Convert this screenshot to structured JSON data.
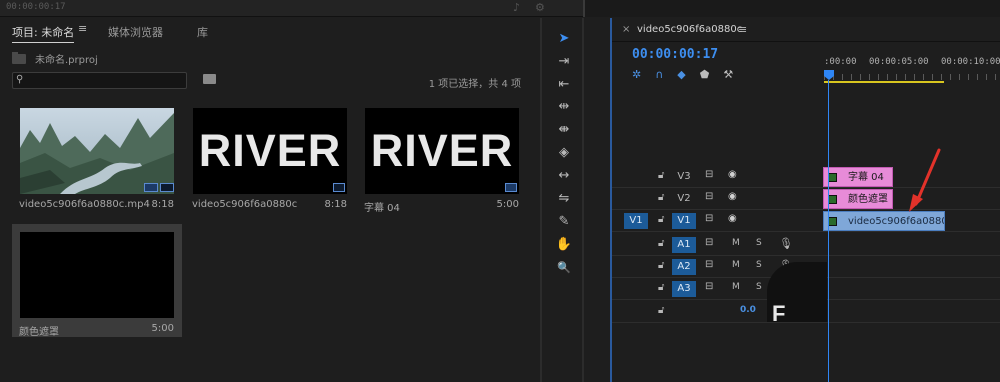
{
  "top_strip": {
    "timecode": "00:00:00:17"
  },
  "project": {
    "tabs": [
      {
        "label": "项目: 未命名"
      },
      {
        "label": "媒体浏览器"
      },
      {
        "label": "库"
      }
    ],
    "tab_menu": "≡",
    "bin_name": "未命名.prproj",
    "search_placeholder": "",
    "selection_status": "1 项已选择，共 4 项",
    "items": [
      {
        "name": "video5c906f6a0880c.mp4",
        "duration": "8:18",
        "kind": "video"
      },
      {
        "name": "video5c906f6a0880c",
        "duration": "8:18",
        "kind": "sequence",
        "thumb_text": "RIVER"
      },
      {
        "name": "字幕 04",
        "duration": "5:00",
        "kind": "title",
        "thumb_text": "RIVER"
      },
      {
        "name": "颜色遮罩",
        "duration": "5:00",
        "kind": "matte"
      }
    ]
  },
  "tools": [
    {
      "name": "selection-tool",
      "glyph": "➤",
      "active": true
    },
    {
      "name": "track-select-tool",
      "glyph": "⇥"
    },
    {
      "name": "ripple-edit-tool",
      "glyph": "⇤"
    },
    {
      "name": "rolling-edit-tool",
      "glyph": "⇹"
    },
    {
      "name": "rate-stretch-tool",
      "glyph": "⇼"
    },
    {
      "name": "razor-tool",
      "glyph": "◈"
    },
    {
      "name": "slip-tool",
      "glyph": "↔"
    },
    {
      "name": "slide-tool",
      "glyph": "⇋"
    },
    {
      "name": "pen-tool",
      "glyph": "✎"
    },
    {
      "name": "hand-tool",
      "glyph": "✋"
    },
    {
      "name": "zoom-tool",
      "glyph": "🔍"
    }
  ],
  "timeline": {
    "sequence_name": "video5c906f6a0880c",
    "close": "×",
    "menu": "≡",
    "timecode": "00:00:00:17",
    "ruler_labels": [
      ":00:00",
      "00:00:05:00",
      "00:00:10:00"
    ],
    "tracks": [
      {
        "type": "video",
        "name": "V3",
        "target": false,
        "src": ""
      },
      {
        "type": "video",
        "name": "V2",
        "target": false,
        "src": ""
      },
      {
        "type": "video",
        "name": "V1",
        "target": true,
        "src": "V1"
      },
      {
        "type": "audio",
        "name": "A1",
        "target": true,
        "src": ""
      },
      {
        "type": "audio",
        "name": "A2",
        "target": true,
        "src": ""
      },
      {
        "type": "audio",
        "name": "A3",
        "target": true,
        "src": ""
      }
    ],
    "master_volume": "0.0",
    "clips": [
      {
        "track": "V3",
        "label": "字幕 04",
        "color": "pink"
      },
      {
        "track": "V2",
        "label": "颜色遮罩",
        "color": "pink"
      },
      {
        "track": "V1",
        "label": "video5c906f6a0880c.mp4",
        "color": "blue"
      }
    ],
    "audio_labels": {
      "mute": "M",
      "solo": "S"
    },
    "overlay_letter": "F"
  }
}
